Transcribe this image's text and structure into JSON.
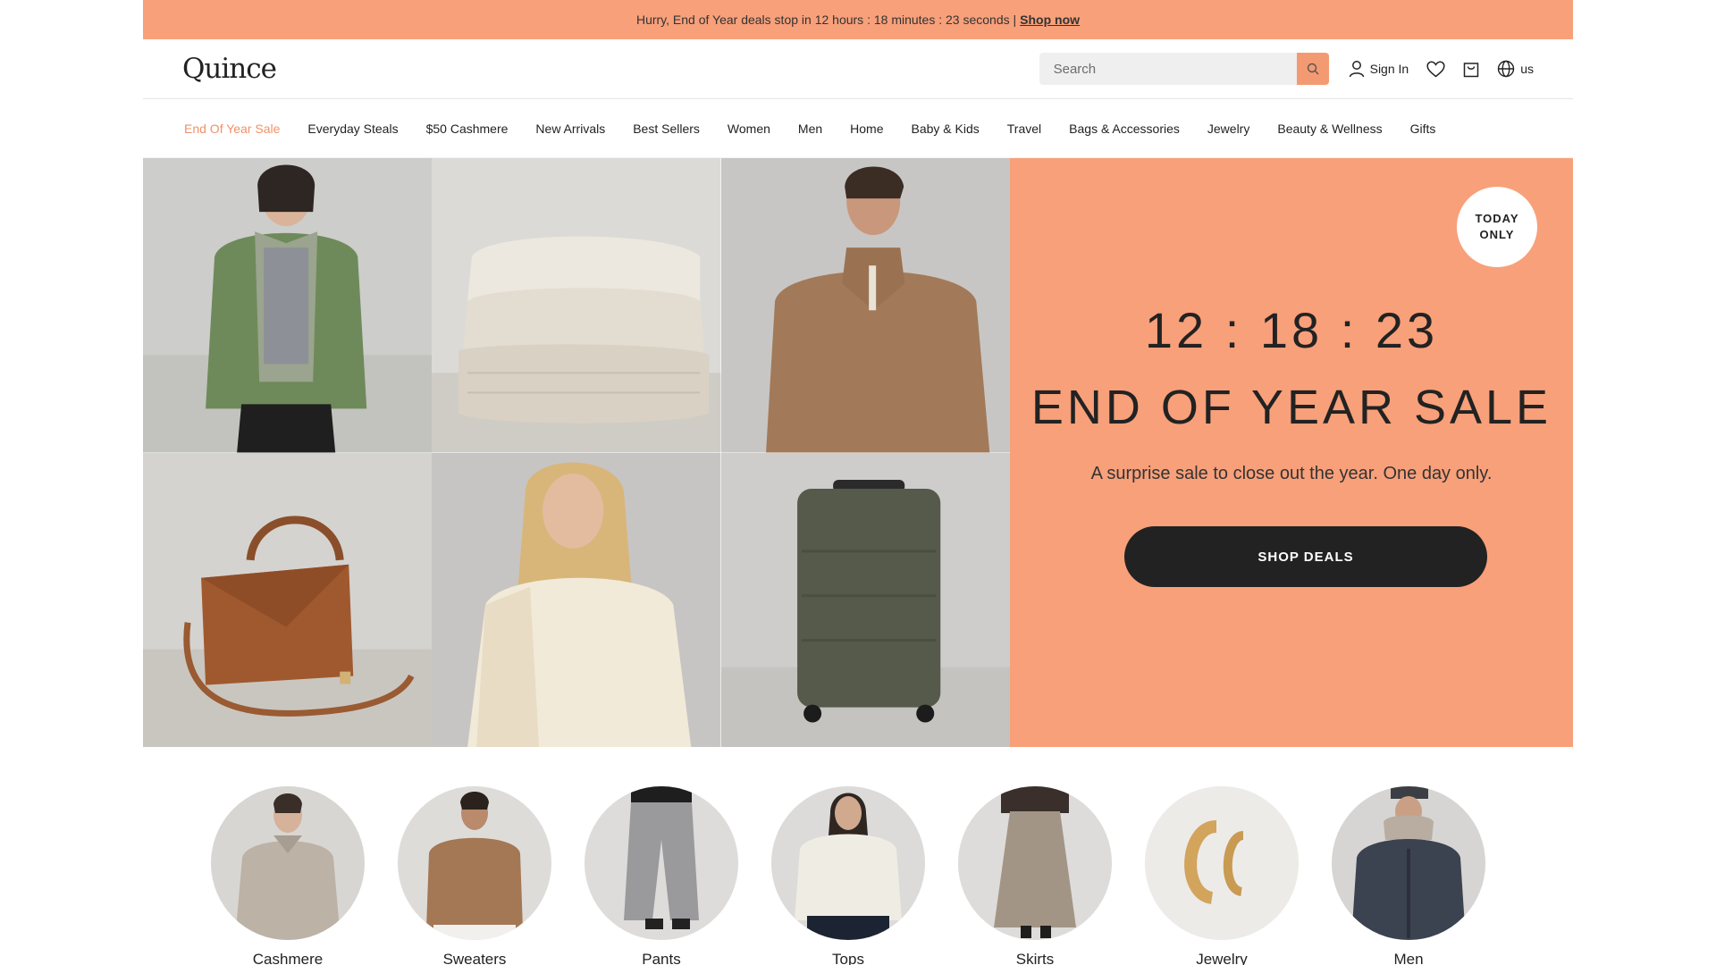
{
  "promo_bar": {
    "text": "Hurry, End of Year deals stop in 12 hours : 18 minutes : 23 seconds |",
    "link": "Shop now"
  },
  "header": {
    "logo": "Quince",
    "search_placeholder": "Search",
    "sign_in": "Sign In",
    "region": "us"
  },
  "nav": {
    "items": [
      "End Of Year Sale",
      "Everyday Steals",
      "$50 Cashmere",
      "New Arrivals",
      "Best Sellers",
      "Women",
      "Men",
      "Home",
      "Baby & Kids",
      "Travel",
      "Bags & Accessories",
      "Jewelry",
      "Beauty & Wellness",
      "Gifts"
    ]
  },
  "hero": {
    "badge_line1": "TODAY",
    "badge_line2": "ONLY",
    "countdown": "12 : 18 : 23",
    "headline": "END OF YEAR SALE",
    "subline": "A surprise sale to close out the year. One day only.",
    "cta": "SHOP DEALS"
  },
  "categories": [
    "Cashmere",
    "Sweaters",
    "Pants",
    "Tops",
    "Skirts",
    "Jewelry",
    "Men"
  ],
  "colors": {
    "accent": "#f8a07a",
    "accent_dark": "#f0916a",
    "cta": "#222222"
  }
}
